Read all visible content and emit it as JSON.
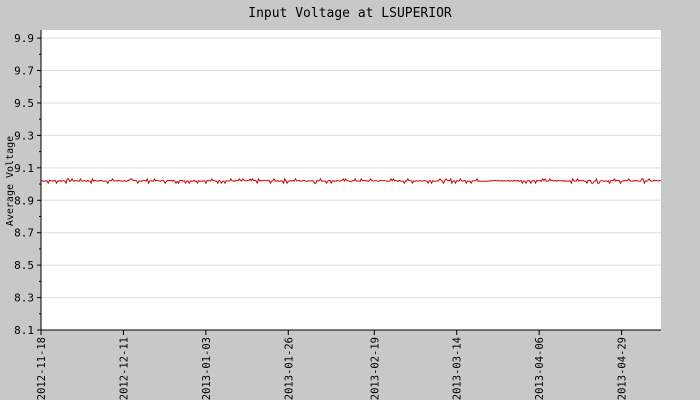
{
  "chart_data": {
    "type": "line",
    "title": "Input Voltage at LSUPERIOR",
    "xlabel": "",
    "ylabel": "Average Voltage",
    "x_range": [
      "2012-11-18",
      "2013-05-10"
    ],
    "ylim": [
      8.1,
      9.95
    ],
    "y_ticks": [
      "8.1",
      "8.3",
      "8.5",
      "8.7",
      "8.9",
      "9.1",
      "9.3",
      "9.5",
      "9.7",
      "9.9"
    ],
    "x_ticks": [
      "2012-11-18",
      "2012-12-11",
      "2013-01-03",
      "2013-01-26",
      "2013-02-19",
      "2013-03-14",
      "2013-04-06",
      "2013-04-29"
    ],
    "grid": true,
    "series": [
      {
        "color": "#cc0000",
        "points": [
          [
            "2012-11-18",
            9.02
          ],
          [
            "2012-11-25",
            9.02
          ],
          [
            "2012-12-02",
            9.02
          ],
          [
            "2012-12-09",
            9.02
          ],
          [
            "2012-12-16",
            9.02
          ],
          [
            "2012-12-23",
            9.02
          ],
          [
            "2012-12-30",
            9.02
          ],
          [
            "2013-01-06",
            9.02
          ],
          [
            "2013-01-13",
            9.02
          ],
          [
            "2013-01-20",
            9.02
          ],
          [
            "2013-01-27",
            9.02
          ],
          [
            "2013-02-03",
            9.02
          ],
          [
            "2013-02-10",
            9.02
          ],
          [
            "2013-02-17",
            9.02
          ],
          [
            "2013-02-24",
            9.02
          ],
          [
            "2013-03-03",
            9.02
          ],
          [
            "2013-03-10",
            9.02
          ],
          [
            "2013-03-17",
            9.02
          ],
          [
            "2013-03-24",
            9.02
          ],
          [
            "2013-03-31",
            9.02
          ],
          [
            "2013-04-07",
            9.02
          ],
          [
            "2013-04-14",
            9.02
          ],
          [
            "2013-04-21",
            9.02
          ],
          [
            "2013-04-28",
            9.02
          ],
          [
            "2013-05-05",
            9.02
          ],
          [
            "2013-05-10",
            9.02
          ]
        ]
      }
    ]
  }
}
